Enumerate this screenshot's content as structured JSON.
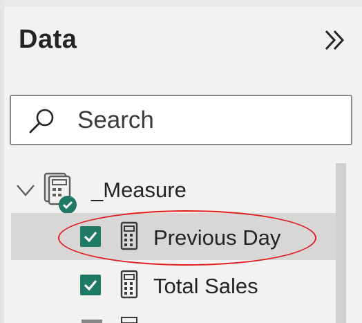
{
  "pane": {
    "title": "Data",
    "collapse_icon": "chevron-double-right-icon"
  },
  "search": {
    "placeholder": "Search",
    "value": "",
    "icon": "search-icon"
  },
  "tree": {
    "table": {
      "name": "_Measure",
      "expanded": true,
      "icon": "measure-table-icon"
    },
    "fields": [
      {
        "label": "Previous Day",
        "checked": true,
        "selected": true,
        "icon": "calculator-icon"
      },
      {
        "label": "Total Sales",
        "checked": true,
        "selected": false,
        "icon": "calculator-icon"
      }
    ]
  },
  "colors": {
    "pane_bg": "#f3f2f1",
    "checkbox": "#1e7a66",
    "selected_row": "#d9d7d5",
    "annotation": "#e01b1b",
    "badge": "#1e7a66"
  }
}
